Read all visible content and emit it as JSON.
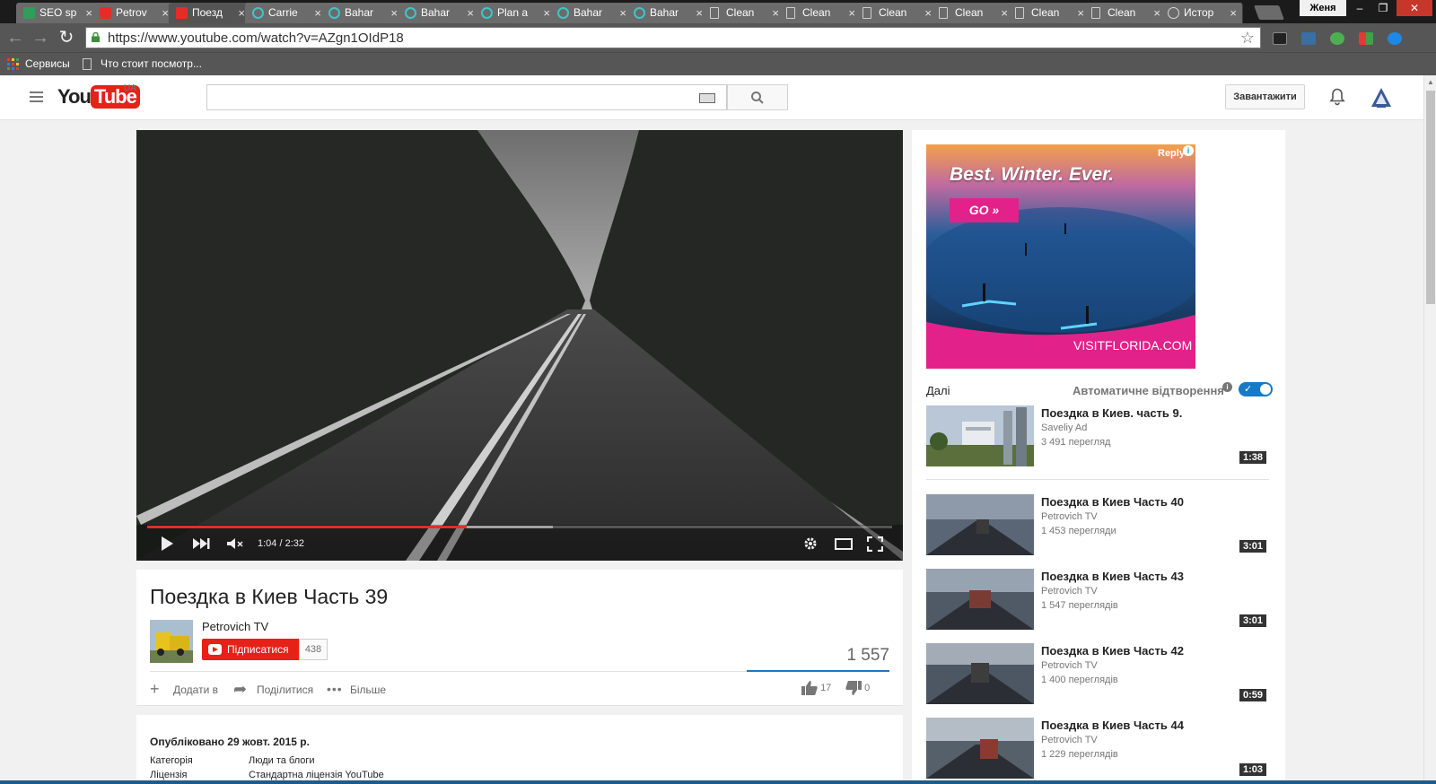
{
  "browser": {
    "tabs": [
      {
        "label": "SEO sp",
        "favicon": "seo-icon"
      },
      {
        "label": "Petrov",
        "favicon": "youtube-icon"
      },
      {
        "label": "Поезд",
        "favicon": "youtube-icon",
        "active": true
      },
      {
        "label": "Carrie",
        "favicon": "teal-ring-icon"
      },
      {
        "label": "Bahar",
        "favicon": "teal-ring-icon"
      },
      {
        "label": "Bahar",
        "favicon": "teal-ring-icon"
      },
      {
        "label": "Plan a",
        "favicon": "teal-ring-icon"
      },
      {
        "label": "Bahar",
        "favicon": "teal-ring-icon"
      },
      {
        "label": "Bahar",
        "favicon": "teal-ring-icon"
      },
      {
        "label": "Clean",
        "favicon": "document-icon"
      },
      {
        "label": "Clean",
        "favicon": "document-icon"
      },
      {
        "label": "Clean",
        "favicon": "document-icon"
      },
      {
        "label": "Clean",
        "favicon": "document-icon"
      },
      {
        "label": "Clean",
        "favicon": "document-icon"
      },
      {
        "label": "Clean",
        "favicon": "document-icon"
      },
      {
        "label": "Истор",
        "favicon": "history-icon"
      }
    ],
    "user": "Женя",
    "url": "https://www.youtube.com/watch?v=AZgn1OIdP18",
    "ext_badge": "4",
    "bookmarks": [
      "Сервисы",
      "Что стоит посмотр..."
    ]
  },
  "yt": {
    "logo_you": "You",
    "logo_tube": "Tube",
    "region": "UA",
    "search_placeholder": "",
    "upload_label": "Завантажити"
  },
  "player": {
    "time_display": "1:04 / 2:32",
    "progress_played": 0.429,
    "progress_loaded": 0.545
  },
  "video": {
    "title": "Поездка в Киев Часть 39",
    "channel": "Petrovich TV",
    "subscribe_label": "Підписатися",
    "subscriber_count": "438",
    "views": "1 557",
    "actions": {
      "add": "Додати в",
      "share": "Поділитися",
      "more": "Більше"
    },
    "likes": "17",
    "dislikes": "0",
    "published": "Опубліковано 29 жовт. 2015 р.",
    "meta": [
      {
        "label": "Категорія",
        "value": "Люди та блоги"
      },
      {
        "label": "Ліцензія",
        "value": "Стандартна ліцензія YouTube"
      }
    ]
  },
  "ad": {
    "headline": "Best. Winter. Ever.",
    "cta": "GO »",
    "brand": "VISITFLORIDA.COM",
    "reply": "Reply",
    "info": "i"
  },
  "sidebar": {
    "up_next": "Далі",
    "autoplay": "Автоматичне відтворення",
    "autoplay_on": true,
    "recommendations": [
      {
        "title": "Поездка в Киев. часть 9.",
        "channel": "Saveliy Ad",
        "views": "3 491 перегляд",
        "duration": "1:38"
      },
      {
        "title": "Поездка в Киев Часть 40",
        "channel": "Petrovich TV",
        "views": "1 453 перегляди",
        "duration": "3:01"
      },
      {
        "title": "Поездка в Киев Часть 43",
        "channel": "Petrovich TV",
        "views": "1 547 переглядів",
        "duration": "3:01"
      },
      {
        "title": "Поездка в Киев Часть 42",
        "channel": "Petrovich TV",
        "views": "1 400 переглядів",
        "duration": "0:59"
      },
      {
        "title": "Поездка в Киев Часть 44",
        "channel": "Petrovich TV",
        "views": "1 229 переглядів",
        "duration": "1:03"
      }
    ]
  },
  "colors": {
    "yt_red": "#e62117",
    "accent_blue": "#167ac6",
    "chrome_dark": "#565656"
  }
}
